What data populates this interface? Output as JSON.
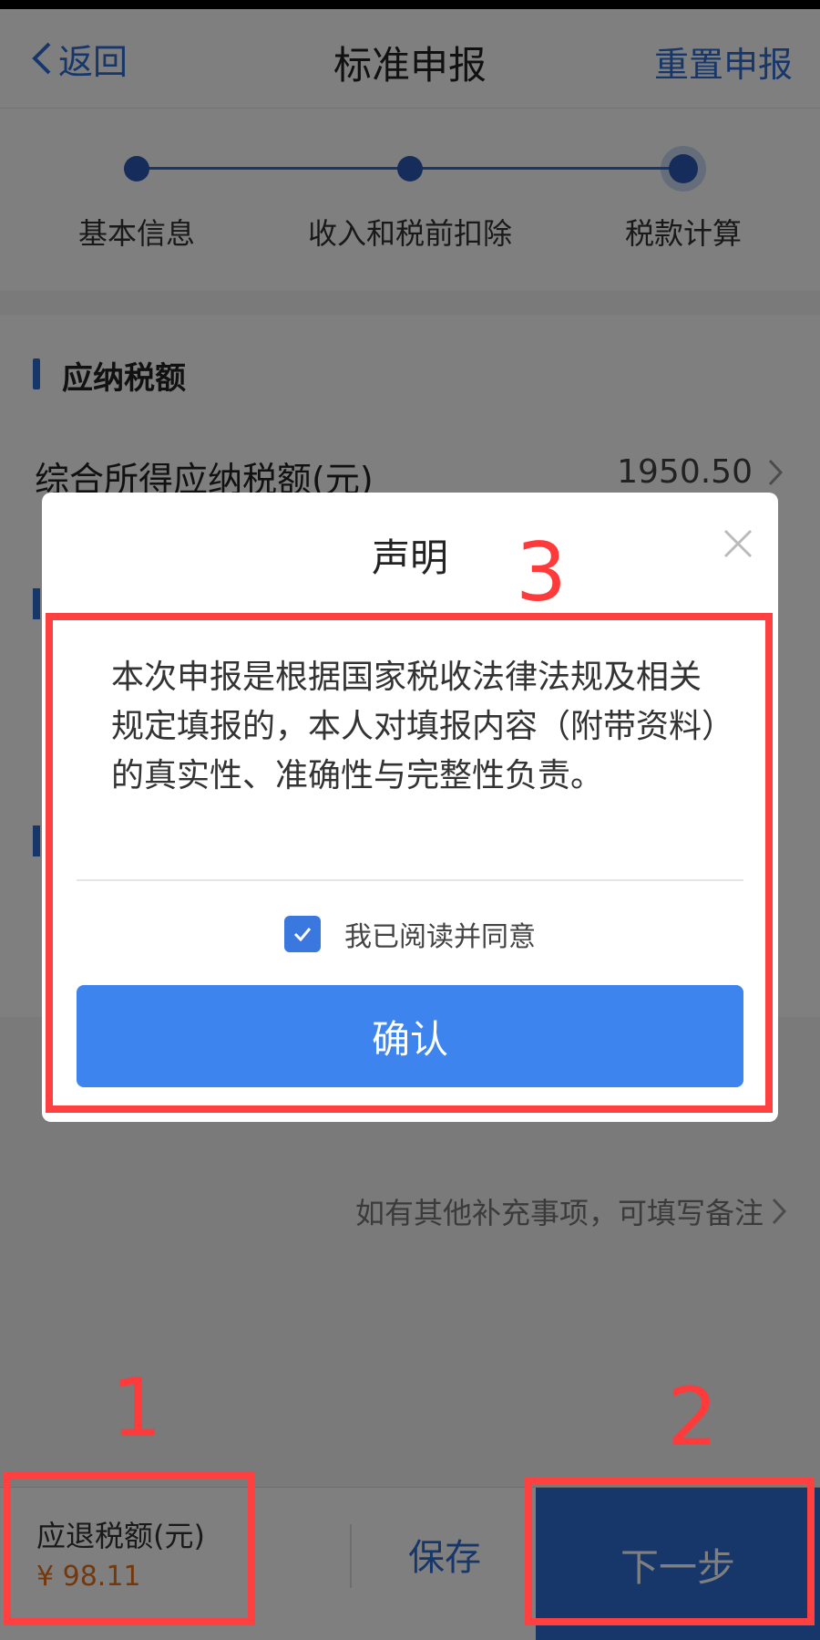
{
  "header": {
    "back_label": "返回",
    "title": "标准申报",
    "reset_label": "重置申报"
  },
  "steps": [
    {
      "label": "基本信息"
    },
    {
      "label": "收入和税前扣除"
    },
    {
      "label": "税款计算"
    }
  ],
  "section": {
    "title": "应纳税额",
    "row_label": "综合所得应纳税额(元)",
    "row_value": "1950.50"
  },
  "remark": {
    "text": "如有其他补充事项，可填写备注"
  },
  "bottom": {
    "refund_label": "应退税额(元)",
    "refund_value": "¥ 98.11",
    "save_label": "保存",
    "next_label": "下一步"
  },
  "dialog": {
    "title": "声明",
    "body": "本次申报是根据国家税收法律法规及相关规定填报的，本人对填报内容（附带资料）的真实性、准确性与完整性负责。",
    "agree_label": "我已阅读并同意",
    "agree_checked": true,
    "confirm_label": "确认"
  },
  "annotations": [
    {
      "number": "1"
    },
    {
      "number": "2"
    },
    {
      "number": "3"
    }
  ],
  "colors": {
    "accent": "#2f6fd6",
    "confirm": "#3e84ee",
    "refund": "#e8701a",
    "annotation": "#ff4040"
  }
}
